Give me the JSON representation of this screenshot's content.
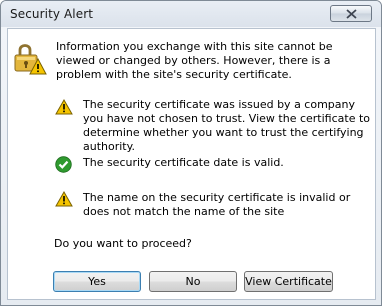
{
  "window": {
    "title": "Security Alert"
  },
  "intro": {
    "text": "Information you exchange with this site cannot be viewed or changed by others. However, there is a problem with the site's security certificate."
  },
  "items": [
    {
      "icon": "warning-icon",
      "text": "The security certificate was issued by a company you have not chosen to trust. View the certificate to determine whether you want to trust the certifying authority."
    },
    {
      "icon": "check-icon",
      "text": "The security certificate date is valid."
    },
    {
      "icon": "warning-icon",
      "text": "The name on the security certificate is invalid or does not match the name of the site"
    }
  ],
  "question": "Do you want to proceed?",
  "buttons": {
    "yes": "Yes",
    "no": "No",
    "view_certificate": "View Certificate"
  },
  "colors": {
    "warning": "#f5c400",
    "ok": "#2f9a2f"
  }
}
